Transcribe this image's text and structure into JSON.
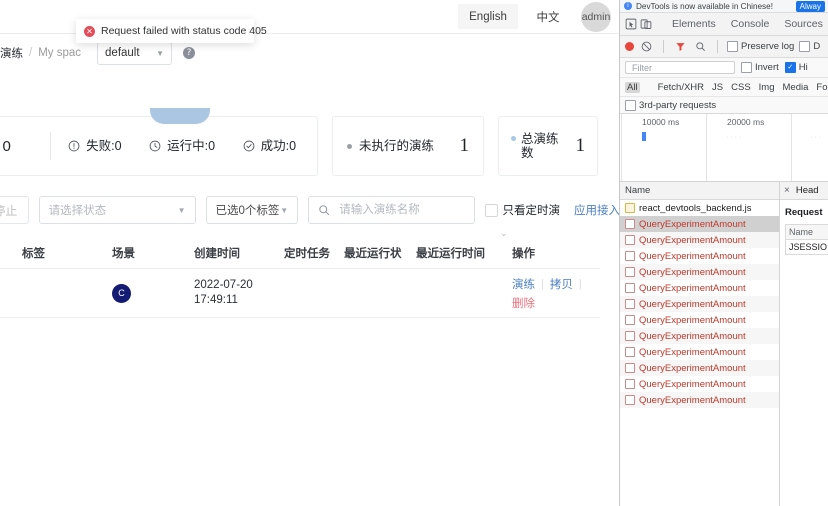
{
  "app": {
    "topbar": {
      "lang_english": "English",
      "lang_chinese": "中文",
      "user": "admin"
    },
    "toast": {
      "icon": "error-circle-icon",
      "message": "Request failed with status code 405"
    },
    "breadcrumb": {
      "item1": "演练",
      "separator": "/",
      "item2": "My spac",
      "space_value": "default",
      "chevron": "▼",
      "help": "?"
    },
    "stats": {
      "cut_value": "0",
      "items": [
        {
          "icon": "warning-circle-icon",
          "label": "失败:0"
        },
        {
          "icon": "clock-icon",
          "label": "运行中:0"
        },
        {
          "icon": "check-circle-icon",
          "label": "成功:0"
        }
      ],
      "card_pending": {
        "dot": "grey",
        "label": "未执行的演练",
        "value": "1"
      },
      "card_total": {
        "dot": "blue",
        "label": "总演练数",
        "value": "1"
      }
    },
    "filters": {
      "stop_all_button": "部停止",
      "status_placeholder": "请选择状态",
      "tags_value": "已选0个标签",
      "search_icon": "search-icon",
      "search_placeholder": "请输入演练名称",
      "search_value": "",
      "timed_checkbox_label": "只看定时演",
      "app_access_link": "应用接入",
      "chevron": "▼"
    },
    "table": {
      "headers": [
        "标签",
        "场景",
        "创建时间",
        "定时任务",
        "最近运行状",
        "最近运行时间",
        "操作"
      ],
      "rows": [
        {
          "tag": "",
          "scene_avatar": "C",
          "created_date": "2022-07-20",
          "created_time": "17:49:11",
          "scheduled_task": "",
          "last_run_status": "",
          "last_run_time": "",
          "ops": [
            "演练",
            "拷贝",
            "删除"
          ],
          "op_separator": "|"
        }
      ]
    }
  },
  "devtools": {
    "banner": {
      "icon": "info-icon",
      "text": "DevTools is now available in Chinese!",
      "button": "Alway"
    },
    "tabs": {
      "inspect_icon": "inspect-cursor-icon",
      "device_icon": "device-toolbar-icon",
      "items": [
        "Elements",
        "Console",
        "Sources"
      ]
    },
    "toolbar": {
      "record_icon": "record-dot-icon",
      "clear_icon": "clear-no-entry-icon",
      "filter_icon": "funnel-icon",
      "search_icon": "search-icon",
      "preserve_log": "Preserve log",
      "disable_cache": "D"
    },
    "filter": {
      "placeholder": "Filter",
      "value": "",
      "invert": "Invert",
      "hide": "Hi"
    },
    "types": [
      "All",
      "Fetch/XHR",
      "JS",
      "CSS",
      "Img",
      "Media",
      "Font"
    ],
    "third_party": "3rd-party requests",
    "timeline": {
      "ticks": [
        "10000 ms",
        "20000 ms"
      ]
    },
    "requests": {
      "column_name": "Name",
      "items": [
        {
          "name": "react_devtools_backend.js",
          "kind": "js",
          "selected": false
        },
        {
          "name": "QueryExperimentAmount",
          "kind": "xhr",
          "selected": true
        },
        {
          "name": "QueryExperimentAmount",
          "kind": "xhr",
          "selected": false
        },
        {
          "name": "QueryExperimentAmount",
          "kind": "xhr",
          "selected": false
        },
        {
          "name": "QueryExperimentAmount",
          "kind": "xhr",
          "selected": false
        },
        {
          "name": "QueryExperimentAmount",
          "kind": "xhr",
          "selected": false
        },
        {
          "name": "QueryExperimentAmount",
          "kind": "xhr",
          "selected": false
        },
        {
          "name": "QueryExperimentAmount",
          "kind": "xhr",
          "selected": false
        },
        {
          "name": "QueryExperimentAmount",
          "kind": "xhr",
          "selected": false
        },
        {
          "name": "QueryExperimentAmount",
          "kind": "xhr",
          "selected": false
        },
        {
          "name": "QueryExperimentAmount",
          "kind": "xhr",
          "selected": false
        },
        {
          "name": "QueryExperimentAmount",
          "kind": "xhr",
          "selected": false
        },
        {
          "name": "QueryExperimentAmount",
          "kind": "xhr",
          "selected": false
        }
      ]
    },
    "detail": {
      "close": "×",
      "tab": "Head",
      "section": "Request",
      "key_header": "Name",
      "key_value": "JSESSIO"
    }
  },
  "colors": {
    "link": "#4a7fc1",
    "danger": "#e8707a",
    "error_red": "#c0392b",
    "devtools_blue": "#1a73e8",
    "avatar_navy": "#131c72",
    "chart_blue": "#aac6e3"
  }
}
